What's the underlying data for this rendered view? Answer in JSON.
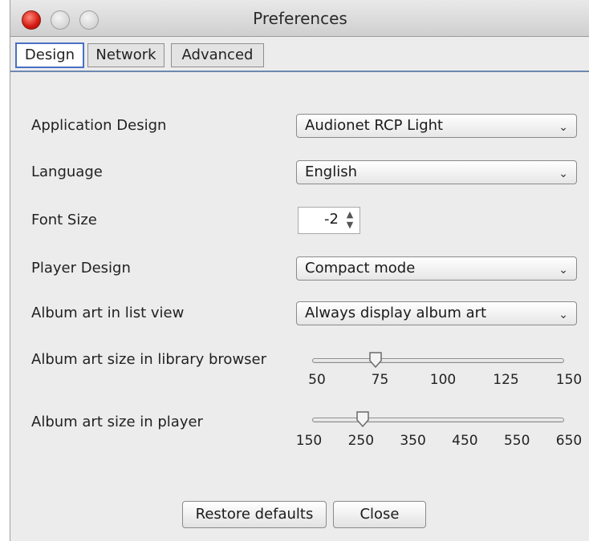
{
  "window": {
    "title": "Preferences"
  },
  "tabs": [
    {
      "label": "Design",
      "active": true
    },
    {
      "label": "Network",
      "active": false
    },
    {
      "label": "Advanced",
      "active": false
    }
  ],
  "design": {
    "application_design": {
      "label": "Application Design",
      "value": "Audionet RCP Light"
    },
    "language": {
      "label": "Language",
      "value": "English"
    },
    "font_size": {
      "label": "Font Size",
      "value": "-2"
    },
    "player_design": {
      "label": "Player Design",
      "value": "Compact mode"
    },
    "album_art_list": {
      "label": "Album art in list view",
      "value": "Always display album art"
    },
    "album_art_library": {
      "label": "Album art size in library browser",
      "ticks": [
        "50",
        "75",
        "100",
        "125",
        "150"
      ],
      "value": 75
    },
    "album_art_player": {
      "label": "Album art size in player",
      "ticks": [
        "150",
        "250",
        "350",
        "450",
        "550",
        "650"
      ],
      "value": 250
    }
  },
  "buttons": {
    "restore": "Restore defaults",
    "close": "Close"
  },
  "colors": {
    "accent": "#4a70c4",
    "close_button": "#d2190f"
  },
  "icons": {
    "dropdown": "chevron-down-icon",
    "spinner": "spinner-arrows-icon",
    "slider_thumb": "slider-thumb-icon"
  }
}
